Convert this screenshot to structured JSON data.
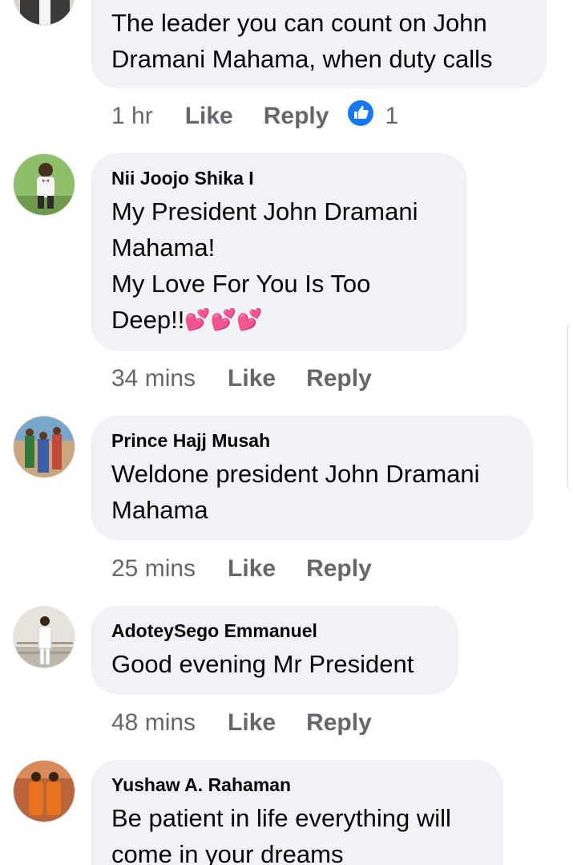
{
  "comments": [
    {
      "text": "The leader you can count on John Dramani Mahama, when duty calls",
      "time": "1 hr",
      "like_label": "Like",
      "reply_label": "Reply",
      "reaction_count": "1",
      "reaction_icon": "thumbs-up-icon",
      "reaction_color": "#1877f2"
    },
    {
      "author": "Nii Joojo Shika I",
      "text_line1": "My President John Dramani Mahama!",
      "text_line2": "My Love For You Is Too Deep!!",
      "emoji": "💕💕💕",
      "time": "34 mins",
      "like_label": "Like",
      "reply_label": "Reply"
    },
    {
      "author": "Prince Hajj Musah",
      "text": "Weldone president John Dramani Mahama",
      "time": "25 mins",
      "like_label": "Like",
      "reply_label": "Reply"
    },
    {
      "author": "AdoteySego Emmanuel",
      "text": "Good evening Mr President",
      "time": "48 mins",
      "like_label": "Like",
      "reply_label": "Reply"
    },
    {
      "author": "Yushaw A. Rahaman",
      "text": "Be patient in life everything will come in your dreams"
    }
  ],
  "colors": {
    "bubble": "#f0f2f5",
    "meta_text": "#65676b",
    "like_blue": "#1877f2"
  }
}
